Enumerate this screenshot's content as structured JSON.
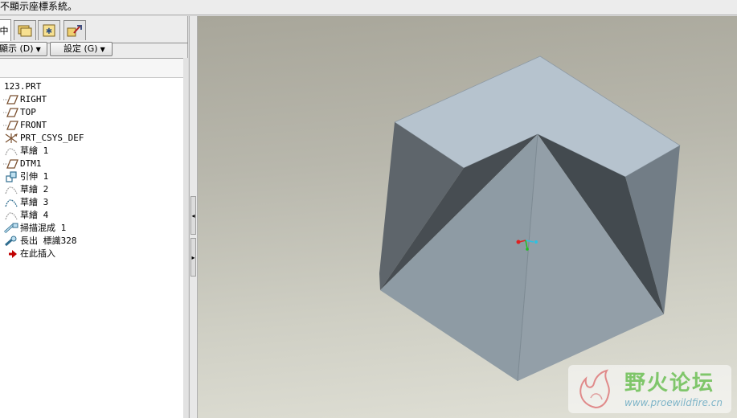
{
  "status_bar": {
    "message": "不顯示座標系統。"
  },
  "tabs": [
    {
      "name": "model-tree",
      "glyph": "中"
    },
    {
      "name": "folder-browser",
      "glyph": "▣"
    },
    {
      "name": "favorites",
      "glyph": "✱"
    },
    {
      "name": "connections",
      "glyph": "⚒"
    }
  ],
  "toolbar": {
    "display_label": "顯示 (D)",
    "settings_label": "設定 (G)"
  },
  "tree": {
    "root": "123.PRT",
    "items": [
      {
        "label": "RIGHT",
        "icon": "datum-plane-icon"
      },
      {
        "label": "TOP",
        "icon": "datum-plane-icon"
      },
      {
        "label": "FRONT",
        "icon": "datum-plane-icon"
      },
      {
        "label": "PRT_CSYS_DEF",
        "icon": "coordinate-system-icon"
      },
      {
        "label": "草繪 1",
        "icon": "sketch-icon"
      },
      {
        "label": "DTM1",
        "icon": "datum-plane-icon"
      },
      {
        "label": "引伸 1",
        "icon": "extrude-icon"
      },
      {
        "label": "草繪 2",
        "icon": "sketch-icon"
      },
      {
        "label": "草繪 3",
        "icon": "sketch-icon"
      },
      {
        "label": "草繪 4",
        "icon": "sketch-icon"
      },
      {
        "label": "掃描混成 1",
        "icon": "swept-blend-icon"
      },
      {
        "label": "長出 標識328",
        "icon": "protrusion-icon"
      },
      {
        "label": "在此插入",
        "icon": "insert-here-icon"
      }
    ]
  },
  "watermark": {
    "title": "野火论坛",
    "url": "www.proewildfire.cn"
  },
  "colors": {
    "model_top": "#b6c3ce",
    "model_front": "#8f9ca5",
    "model_left": "#5e656b",
    "model_right": "#707b83",
    "model_notch_dark": "#454b50",
    "csys_x": "#e02020",
    "csys_y": "#20c020",
    "csys_z": "#30c0e0",
    "insert_arrow": "#c00000"
  }
}
